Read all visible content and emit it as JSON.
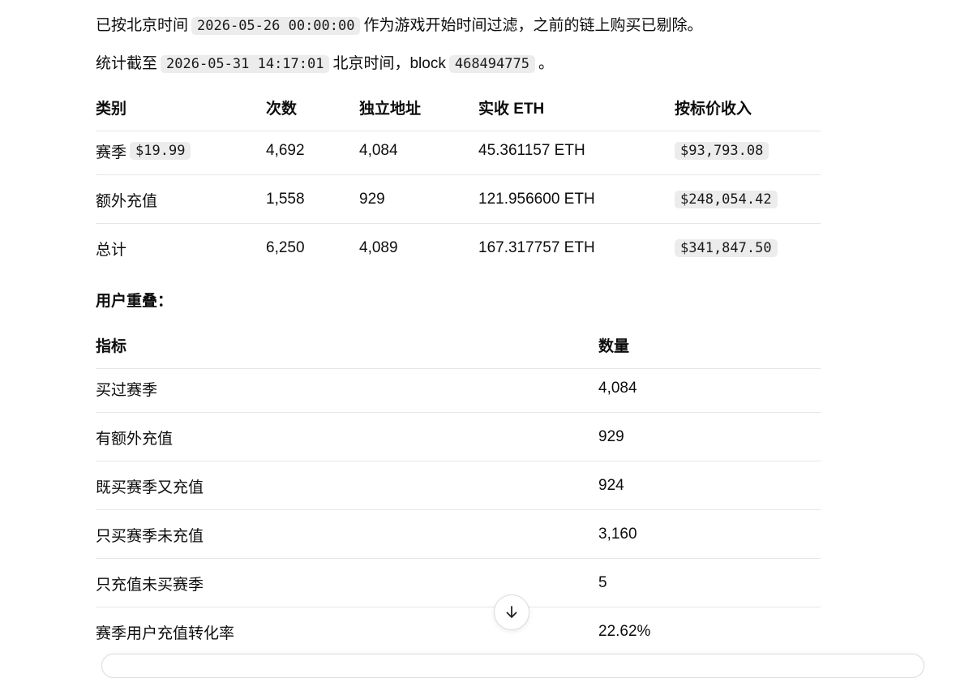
{
  "intro": {
    "line1_prefix": "已按北京时间",
    "line1_code": "2026-05-26 00:00:00",
    "line1_suffix": "作为游戏开始时间过滤，之前的链上购买已剔除。",
    "line2_prefix": "统计截至",
    "line2_code": "2026-05-31 14:17:01",
    "line2_mid": "北京时间，block",
    "line2_block": "468494775",
    "line2_suffix": "。"
  },
  "table1": {
    "headers": [
      "类别",
      "次数",
      "独立地址",
      "实收 ETH",
      "按标价收入"
    ],
    "rows": [
      {
        "category": "赛季",
        "category_code": "$19.99",
        "count": "4,692",
        "addresses": "4,084",
        "eth": "45.361157 ETH",
        "usd": "$93,793.08"
      },
      {
        "category": "额外充值",
        "category_code": "",
        "count": "1,558",
        "addresses": "929",
        "eth": "121.956600 ETH",
        "usd": "$248,054.42"
      },
      {
        "category": "总计",
        "category_code": "",
        "count": "6,250",
        "addresses": "4,089",
        "eth": "167.317757 ETH",
        "usd": "$341,847.50"
      }
    ]
  },
  "overlap_title": "用户重叠：",
  "table2": {
    "headers": [
      "指标",
      "数量"
    ],
    "rows": [
      {
        "metric": "买过赛季",
        "value": "4,084"
      },
      {
        "metric": "有额外充值",
        "value": "929"
      },
      {
        "metric": "既买赛季又充值",
        "value": "924"
      },
      {
        "metric": "只买赛季未充值",
        "value": "3,160"
      },
      {
        "metric": "只充值未买赛季",
        "value": "5"
      },
      {
        "metric": "赛季用户充值转化率",
        "value": "22.62%"
      }
    ]
  },
  "icons": {
    "scroll": "arrow-down-icon"
  }
}
